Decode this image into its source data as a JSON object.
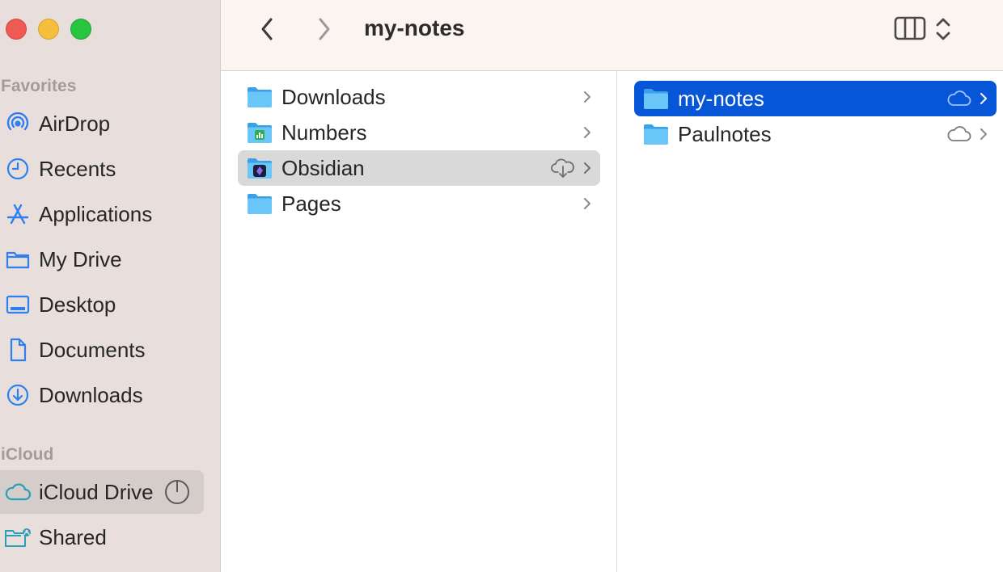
{
  "window": {
    "title": "my-notes"
  },
  "sidebar": {
    "favorites_title": "Favorites",
    "favorites": [
      {
        "label": "AirDrop",
        "icon": "airdrop-icon"
      },
      {
        "label": "Recents",
        "icon": "clock-icon"
      },
      {
        "label": "Applications",
        "icon": "applications-icon"
      },
      {
        "label": "My Drive",
        "icon": "folder-icon"
      },
      {
        "label": "Desktop",
        "icon": "desktop-icon"
      },
      {
        "label": "Documents",
        "icon": "document-icon"
      },
      {
        "label": "Downloads",
        "icon": "download-icon"
      }
    ],
    "icloud_title": "iCloud",
    "icloud": [
      {
        "label": "iCloud Drive",
        "icon": "cloud-icon",
        "selected": true
      },
      {
        "label": "Shared",
        "icon": "shared-folder-icon"
      }
    ]
  },
  "column1": {
    "items": [
      {
        "label": "Downloads",
        "icon": "folder-icon",
        "cloud": false
      },
      {
        "label": "Numbers",
        "icon": "numbers-folder-icon",
        "cloud": false
      },
      {
        "label": "Obsidian",
        "icon": "obsidian-folder-icon",
        "cloud": true,
        "selected": true
      },
      {
        "label": "Pages",
        "icon": "folder-icon",
        "cloud": false
      }
    ]
  },
  "column2": {
    "items": [
      {
        "label": "my-notes",
        "icon": "folder-icon",
        "cloud": true,
        "selected": true
      },
      {
        "label": "Paulnotes",
        "icon": "folder-icon",
        "cloud": true
      }
    ]
  },
  "colors": {
    "accent": "#0756d7",
    "sidebar_icon": "#2f7ff0",
    "icloud_icon": "#2a9fb8",
    "folder": "#5ab9f2"
  }
}
